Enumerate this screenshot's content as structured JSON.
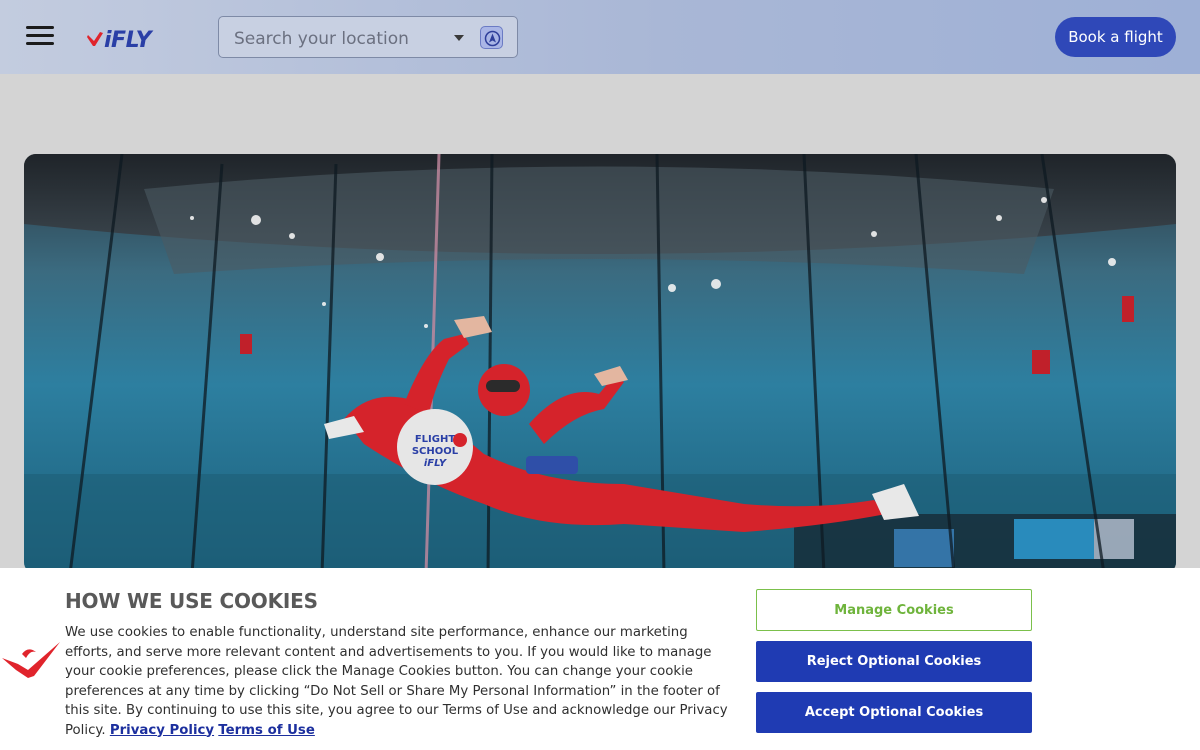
{
  "header": {
    "logo_text": "iFLY",
    "search": {
      "placeholder": "Search your location"
    },
    "book_label": "Book a flight"
  },
  "hero": {
    "badge_text": "FLIGHT SCHOOL iFLY"
  },
  "cookie_banner": {
    "title": "HOW WE USE COOKIES",
    "body": "We use cookies to enable functionality, understand site performance, enhance our marketing efforts, and serve more relevant content and advertisements to you. If you would like to manage your cookie preferences, please click the Manage Cookies button. You can change your cookie preferences at any time by clicking “Do Not Sell or Share My Personal Information” in the footer of this site. By continuing to use this site, you agree to our Terms of Use and acknowledge our Privacy Policy.",
    "privacy_link": "Privacy Policy",
    "terms_link": "Terms of Use",
    "manage_label": "Manage Cookies",
    "reject_label": "Reject Optional Cookies",
    "accept_label": "Accept Optional Cookies"
  },
  "colors": {
    "brand_blue": "#2f48b8",
    "brand_red": "#e0242c",
    "manage_green": "#6fb43c"
  }
}
